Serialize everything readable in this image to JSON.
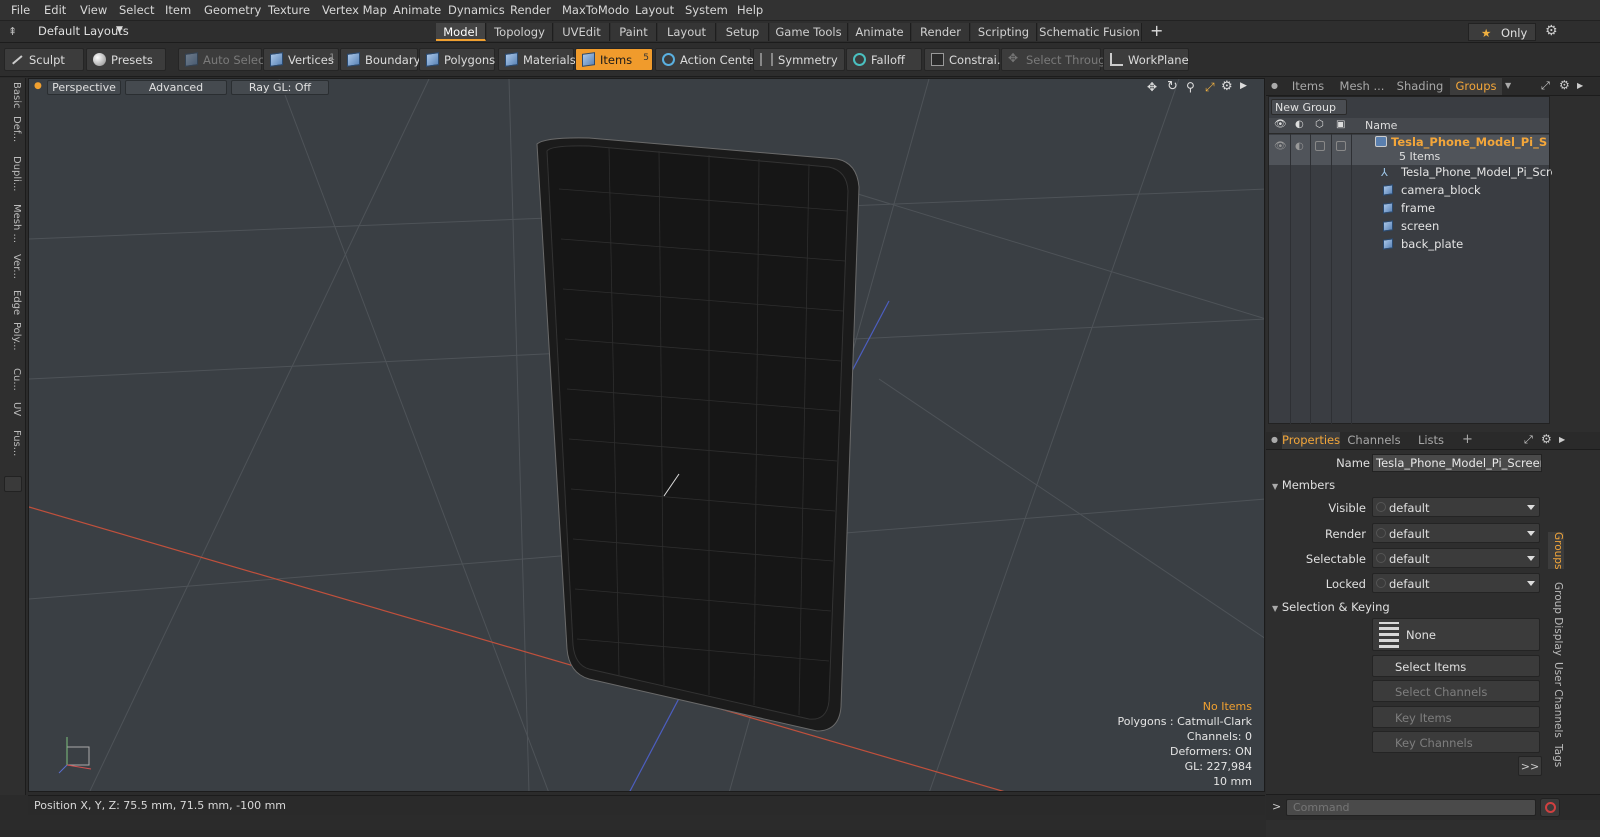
{
  "menu": [
    "File",
    "Edit",
    "View",
    "Select",
    "Item",
    "Geometry",
    "Texture",
    "Vertex Map",
    "Animate",
    "Dynamics",
    "Render",
    "MaxToModo",
    "Layout",
    "System",
    "Help"
  ],
  "layout_dropdown": "Default Layouts",
  "mode_tabs": [
    "Model",
    "Topology",
    "UVEdit",
    "Paint",
    "Layout",
    "Setup",
    "Game Tools",
    "Animate",
    "Render",
    "Scripting",
    "Schematic Fusion"
  ],
  "only_label": "Only",
  "toolbar": {
    "sculpt": "Sculpt",
    "presets": "Presets",
    "auto_select": "Auto Select",
    "vertices": "Vertices",
    "vertices_count": "1",
    "boundary": "Boundary",
    "polygons": "Polygons",
    "materials": "Materials",
    "items": "Items",
    "items_count": "5",
    "action_center": "Action Center",
    "symmetry": "Symmetry",
    "falloff": "Falloff",
    "constraints": "Constrai...",
    "select_through": "Select Through",
    "workplane": "WorkPlane"
  },
  "left_tabs": [
    "Basic",
    "Def...",
    "Dupli...",
    "Mesh ...",
    "Ver...",
    "Edge",
    "Poly...",
    "Cu...",
    "UV",
    "Fus..."
  ],
  "viewport": {
    "view": "Perspective",
    "shading": "Advanced",
    "raygl": "Ray GL: Off",
    "info": [
      "No Items",
      "Polygons : Catmull-Clark",
      "Channels: 0",
      "Deformers: ON",
      "GL: 227,984",
      "10 mm"
    ]
  },
  "status": "Position X, Y, Z:  75.5 mm, 71.5 mm, -100 mm",
  "outliner": {
    "tabs": [
      "Items",
      "Mesh ...",
      "Shading",
      "Groups"
    ],
    "new_group": "New Group",
    "col_name": "Name",
    "group_name": "Tesla_Phone_Model_Pi_S ...",
    "group_count": "5 Items",
    "children": [
      "Tesla_Phone_Model_Pi_Scre...",
      "camera_block",
      "frame",
      "screen",
      "back_plate"
    ]
  },
  "properties": {
    "tabs": [
      "Properties",
      "Channels",
      "Lists"
    ],
    "name_label": "Name",
    "name_value": "Tesla_Phone_Model_Pi_Screen_C",
    "members": "Members",
    "rows": [
      {
        "label": "Visible",
        "value": "default"
      },
      {
        "label": "Render",
        "value": "default"
      },
      {
        "label": "Selectable",
        "value": "default"
      },
      {
        "label": "Locked",
        "value": "default"
      }
    ],
    "sel_keying": "Selection & Keying",
    "none": "None",
    "select_items": "Select Items",
    "select_channels": "Select Channels",
    "key_items": "Key Items",
    "key_channels": "Key Channels",
    "more": ">>",
    "side_tabs": [
      "Groups",
      "Group Display",
      "User Channels",
      "Tags"
    ]
  },
  "command_placeholder": "Command",
  "colors": {
    "accent": "#f09b2c",
    "viewport_bg": "#3a3f44"
  }
}
